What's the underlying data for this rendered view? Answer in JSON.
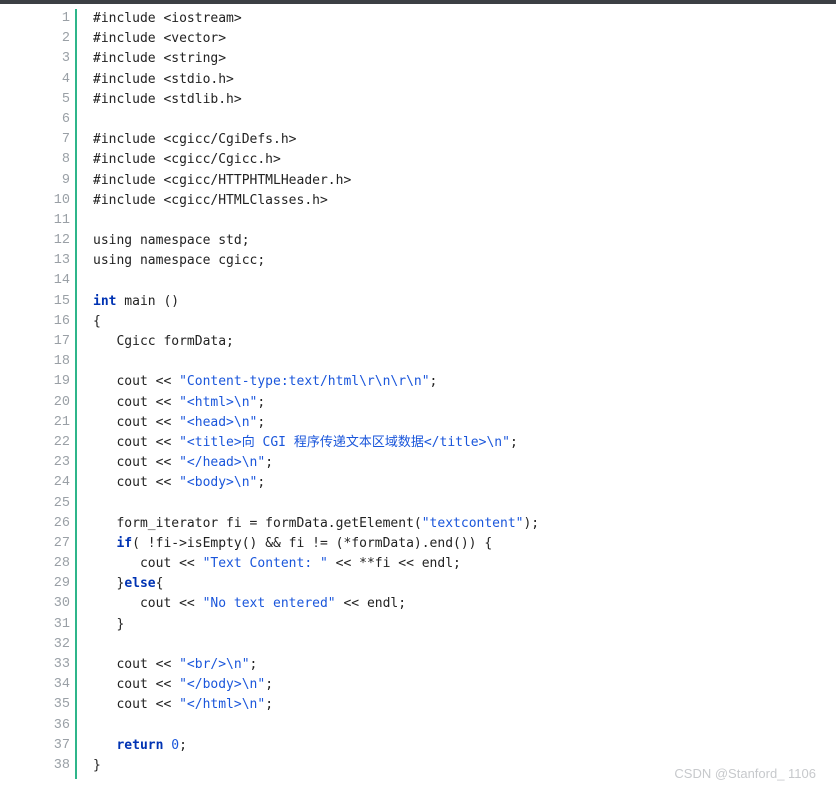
{
  "window": {
    "title": ""
  },
  "editor": {
    "line_numbers": [
      "1",
      "2",
      "3",
      "4",
      "5",
      "6",
      "7",
      "8",
      "9",
      "10",
      "11",
      "12",
      "13",
      "14",
      "15",
      "16",
      "17",
      "18",
      "19",
      "20",
      "21",
      "22",
      "23",
      "24",
      "25",
      "26",
      "27",
      "28",
      "29",
      "30",
      "31",
      "32",
      "33",
      "34",
      "35",
      "36",
      "37",
      "38"
    ],
    "lines": [
      {
        "segments": [
          {
            "t": "#include <iostream>",
            "k": "plain"
          }
        ]
      },
      {
        "segments": [
          {
            "t": "#include <vector>",
            "k": "plain"
          }
        ]
      },
      {
        "segments": [
          {
            "t": "#include <string>",
            "k": "plain"
          }
        ]
      },
      {
        "segments": [
          {
            "t": "#include <stdio.h>",
            "k": "plain"
          }
        ]
      },
      {
        "segments": [
          {
            "t": "#include <stdlib.h>",
            "k": "plain"
          }
        ]
      },
      {
        "segments": []
      },
      {
        "segments": [
          {
            "t": "#include <cgicc/CgiDefs.h>",
            "k": "plain"
          }
        ]
      },
      {
        "segments": [
          {
            "t": "#include <cgicc/Cgicc.h>",
            "k": "plain"
          }
        ]
      },
      {
        "segments": [
          {
            "t": "#include <cgicc/HTTPHTMLHeader.h>",
            "k": "plain"
          }
        ]
      },
      {
        "segments": [
          {
            "t": "#include <cgicc/HTMLClasses.h>",
            "k": "plain"
          }
        ]
      },
      {
        "segments": []
      },
      {
        "segments": [
          {
            "t": "using namespace std;",
            "k": "plain"
          }
        ]
      },
      {
        "segments": [
          {
            "t": "using namespace cgicc;",
            "k": "plain"
          }
        ]
      },
      {
        "segments": []
      },
      {
        "segments": [
          {
            "t": "int",
            "k": "kw"
          },
          {
            "t": " main ()",
            "k": "plain"
          }
        ]
      },
      {
        "segments": [
          {
            "t": "{",
            "k": "plain"
          }
        ]
      },
      {
        "segments": [
          {
            "t": "   Cgicc formData;",
            "k": "plain"
          }
        ]
      },
      {
        "segments": []
      },
      {
        "segments": [
          {
            "t": "   cout << ",
            "k": "plain"
          },
          {
            "t": "\"Content-type:text/html\\r\\n\\r\\n\"",
            "k": "str"
          },
          {
            "t": ";",
            "k": "plain"
          }
        ]
      },
      {
        "segments": [
          {
            "t": "   cout << ",
            "k": "plain"
          },
          {
            "t": "\"<html>\\n\"",
            "k": "str"
          },
          {
            "t": ";",
            "k": "plain"
          }
        ]
      },
      {
        "segments": [
          {
            "t": "   cout << ",
            "k": "plain"
          },
          {
            "t": "\"<head>\\n\"",
            "k": "str"
          },
          {
            "t": ";",
            "k": "plain"
          }
        ]
      },
      {
        "segments": [
          {
            "t": "   cout << ",
            "k": "plain"
          },
          {
            "t": "\"<title>向 CGI 程序传递文本区域数据</title>\\n\"",
            "k": "str"
          },
          {
            "t": ";",
            "k": "plain"
          }
        ]
      },
      {
        "segments": [
          {
            "t": "   cout << ",
            "k": "plain"
          },
          {
            "t": "\"</head>\\n\"",
            "k": "str"
          },
          {
            "t": ";",
            "k": "plain"
          }
        ]
      },
      {
        "segments": [
          {
            "t": "   cout << ",
            "k": "plain"
          },
          {
            "t": "\"<body>\\n\"",
            "k": "str"
          },
          {
            "t": ";",
            "k": "plain"
          }
        ]
      },
      {
        "segments": []
      },
      {
        "segments": [
          {
            "t": "   form_iterator fi = formData.getElement(",
            "k": "plain"
          },
          {
            "t": "\"textcontent\"",
            "k": "str"
          },
          {
            "t": ");",
            "k": "plain"
          }
        ]
      },
      {
        "segments": [
          {
            "t": "   ",
            "k": "plain"
          },
          {
            "t": "if",
            "k": "kw"
          },
          {
            "t": "( !fi->isEmpty() && fi != (*formData).end()) {",
            "k": "plain"
          }
        ]
      },
      {
        "segments": [
          {
            "t": "      cout << ",
            "k": "plain"
          },
          {
            "t": "\"Text Content: \"",
            "k": "str"
          },
          {
            "t": " << **fi << endl;",
            "k": "plain"
          }
        ]
      },
      {
        "segments": [
          {
            "t": "   }",
            "k": "plain"
          },
          {
            "t": "else",
            "k": "kw"
          },
          {
            "t": "{",
            "k": "plain"
          }
        ]
      },
      {
        "segments": [
          {
            "t": "      cout << ",
            "k": "plain"
          },
          {
            "t": "\"No text entered\"",
            "k": "str"
          },
          {
            "t": " << endl;",
            "k": "plain"
          }
        ]
      },
      {
        "segments": [
          {
            "t": "   }",
            "k": "plain"
          }
        ]
      },
      {
        "segments": []
      },
      {
        "segments": [
          {
            "t": "   cout << ",
            "k": "plain"
          },
          {
            "t": "\"<br/>\\n\"",
            "k": "str"
          },
          {
            "t": ";",
            "k": "plain"
          }
        ]
      },
      {
        "segments": [
          {
            "t": "   cout << ",
            "k": "plain"
          },
          {
            "t": "\"</body>\\n\"",
            "k": "str"
          },
          {
            "t": ";",
            "k": "plain"
          }
        ]
      },
      {
        "segments": [
          {
            "t": "   cout << ",
            "k": "plain"
          },
          {
            "t": "\"</html>\\n\"",
            "k": "str"
          },
          {
            "t": ";",
            "k": "plain"
          }
        ]
      },
      {
        "segments": []
      },
      {
        "segments": [
          {
            "t": "   ",
            "k": "plain"
          },
          {
            "t": "return",
            "k": "kw"
          },
          {
            "t": " ",
            "k": "plain"
          },
          {
            "t": "0",
            "k": "num"
          },
          {
            "t": ";",
            "k": "plain"
          }
        ]
      },
      {
        "segments": [
          {
            "t": "}",
            "k": "plain"
          }
        ]
      }
    ]
  },
  "watermark": {
    "text": "CSDN @Stanford_ 1106"
  },
  "colors": {
    "gutter_accent": "#2fb58a",
    "keyword": "#0033b3",
    "string": "#1a56db",
    "number": "#1a56db",
    "text": "#222222",
    "line_number": "#9aa0a6"
  }
}
